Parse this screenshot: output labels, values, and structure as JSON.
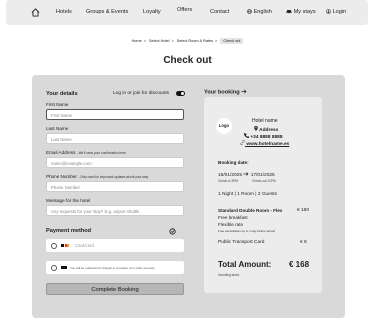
{
  "nav": {
    "home_icon": "home-icon",
    "hotels": "Hotels",
    "groups": "Groups & Events",
    "loyalty": "Loyalty",
    "offers": "Offers",
    "contact": "Contact",
    "language_icon": "globe-icon",
    "language": "English",
    "stays_icon": "car-icon",
    "stays": "My stays",
    "login_icon": "user-icon",
    "login": "Login"
  },
  "breadcrumb": [
    "Home",
    "Select Hotel",
    "Select Room & Rates",
    "Check out"
  ],
  "page_title": "Check out",
  "details": {
    "title": "Your details",
    "login_prompt": "Log in or join for discounts",
    "first_name_label": "First Name",
    "first_name_placeholder": "First Name",
    "last_name_label": "Last Name",
    "last_name_placeholder": "Last Name",
    "email_label": "Email Address",
    "email_note": "- We'll send your confirmation here",
    "email_placeholder": "name@example.com",
    "phone_label": "Phone Number",
    "phone_note": "- Only used for important updates about your stay",
    "phone_placeholder": "Phone Number",
    "message_label": "Message for the hotel",
    "message_placeholder": "Any requests for your stay? E.g. airport shuttle"
  },
  "payment": {
    "title": "Payment method",
    "card_placeholder": "Card/card",
    "option2_text": "You will be redirected to Paypal to complete your order securely",
    "submit": "Complete Booking"
  },
  "booking": {
    "title": "Your booking",
    "logo": "Logo",
    "hotel_name": "Hotel name",
    "address": "Address",
    "phone": "+34 8888 8888",
    "website": "www.hotelname.es",
    "dates_label": "Booking date:",
    "checkin_date": "16/01/2025",
    "checkout_date": "17/01/2025",
    "checkin_label": "Check-in  3PM",
    "checkout_label": "Check-out 11PM",
    "summary": "1 Night | 1 Room | 2 Guests",
    "room_name": "Standard Double Room - Flex",
    "room_price": "€ 160",
    "breakfast": "Free breakfast",
    "flexible": "Flexible rate",
    "cancellation": "Free cancellation up to 1 day before arrival",
    "transport": "Public Transport Card",
    "transport_price": "€ 8",
    "total_label": "Total Amount:",
    "total_price": "€ 168",
    "taxes": "Including  taxes"
  }
}
